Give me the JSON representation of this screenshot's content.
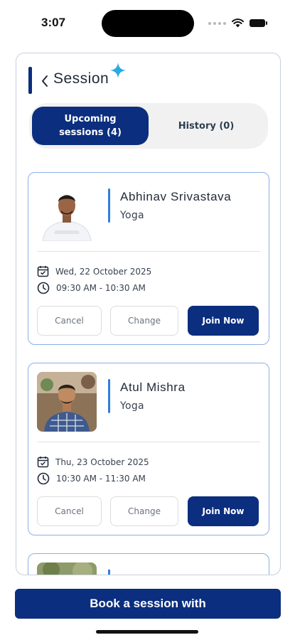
{
  "status_bar": {
    "time": "3:07"
  },
  "header": {
    "title": "Session"
  },
  "tabs": {
    "upcoming_line1": "Upcoming",
    "upcoming_line2": "sessions (4)",
    "history": "History (0)"
  },
  "sessions": [
    {
      "name": "Abhinav Srivastava",
      "category": "Yoga",
      "date": "Wed, 22 October 2025",
      "time": "09:30 AM - 10:30 AM",
      "cancel_label": "Cancel",
      "change_label": "Change",
      "join_label": "Join Now"
    },
    {
      "name": "Atul Mishra",
      "category": "Yoga",
      "date": "Thu, 23 October 2025",
      "time": "10:30 AM - 11:30 AM",
      "cancel_label": "Cancel",
      "change_label": "Change",
      "join_label": "Join Now"
    }
  ],
  "footer": {
    "book_label": "Book a session with"
  },
  "icons": [
    "back-icon",
    "sparkle-icon",
    "calendar-icon",
    "clock-icon",
    "wifi-icon",
    "battery-icon"
  ],
  "colors": {
    "primary": "#0b2e7e",
    "accent": "#2f7de1",
    "card_border": "#8db0e8"
  }
}
